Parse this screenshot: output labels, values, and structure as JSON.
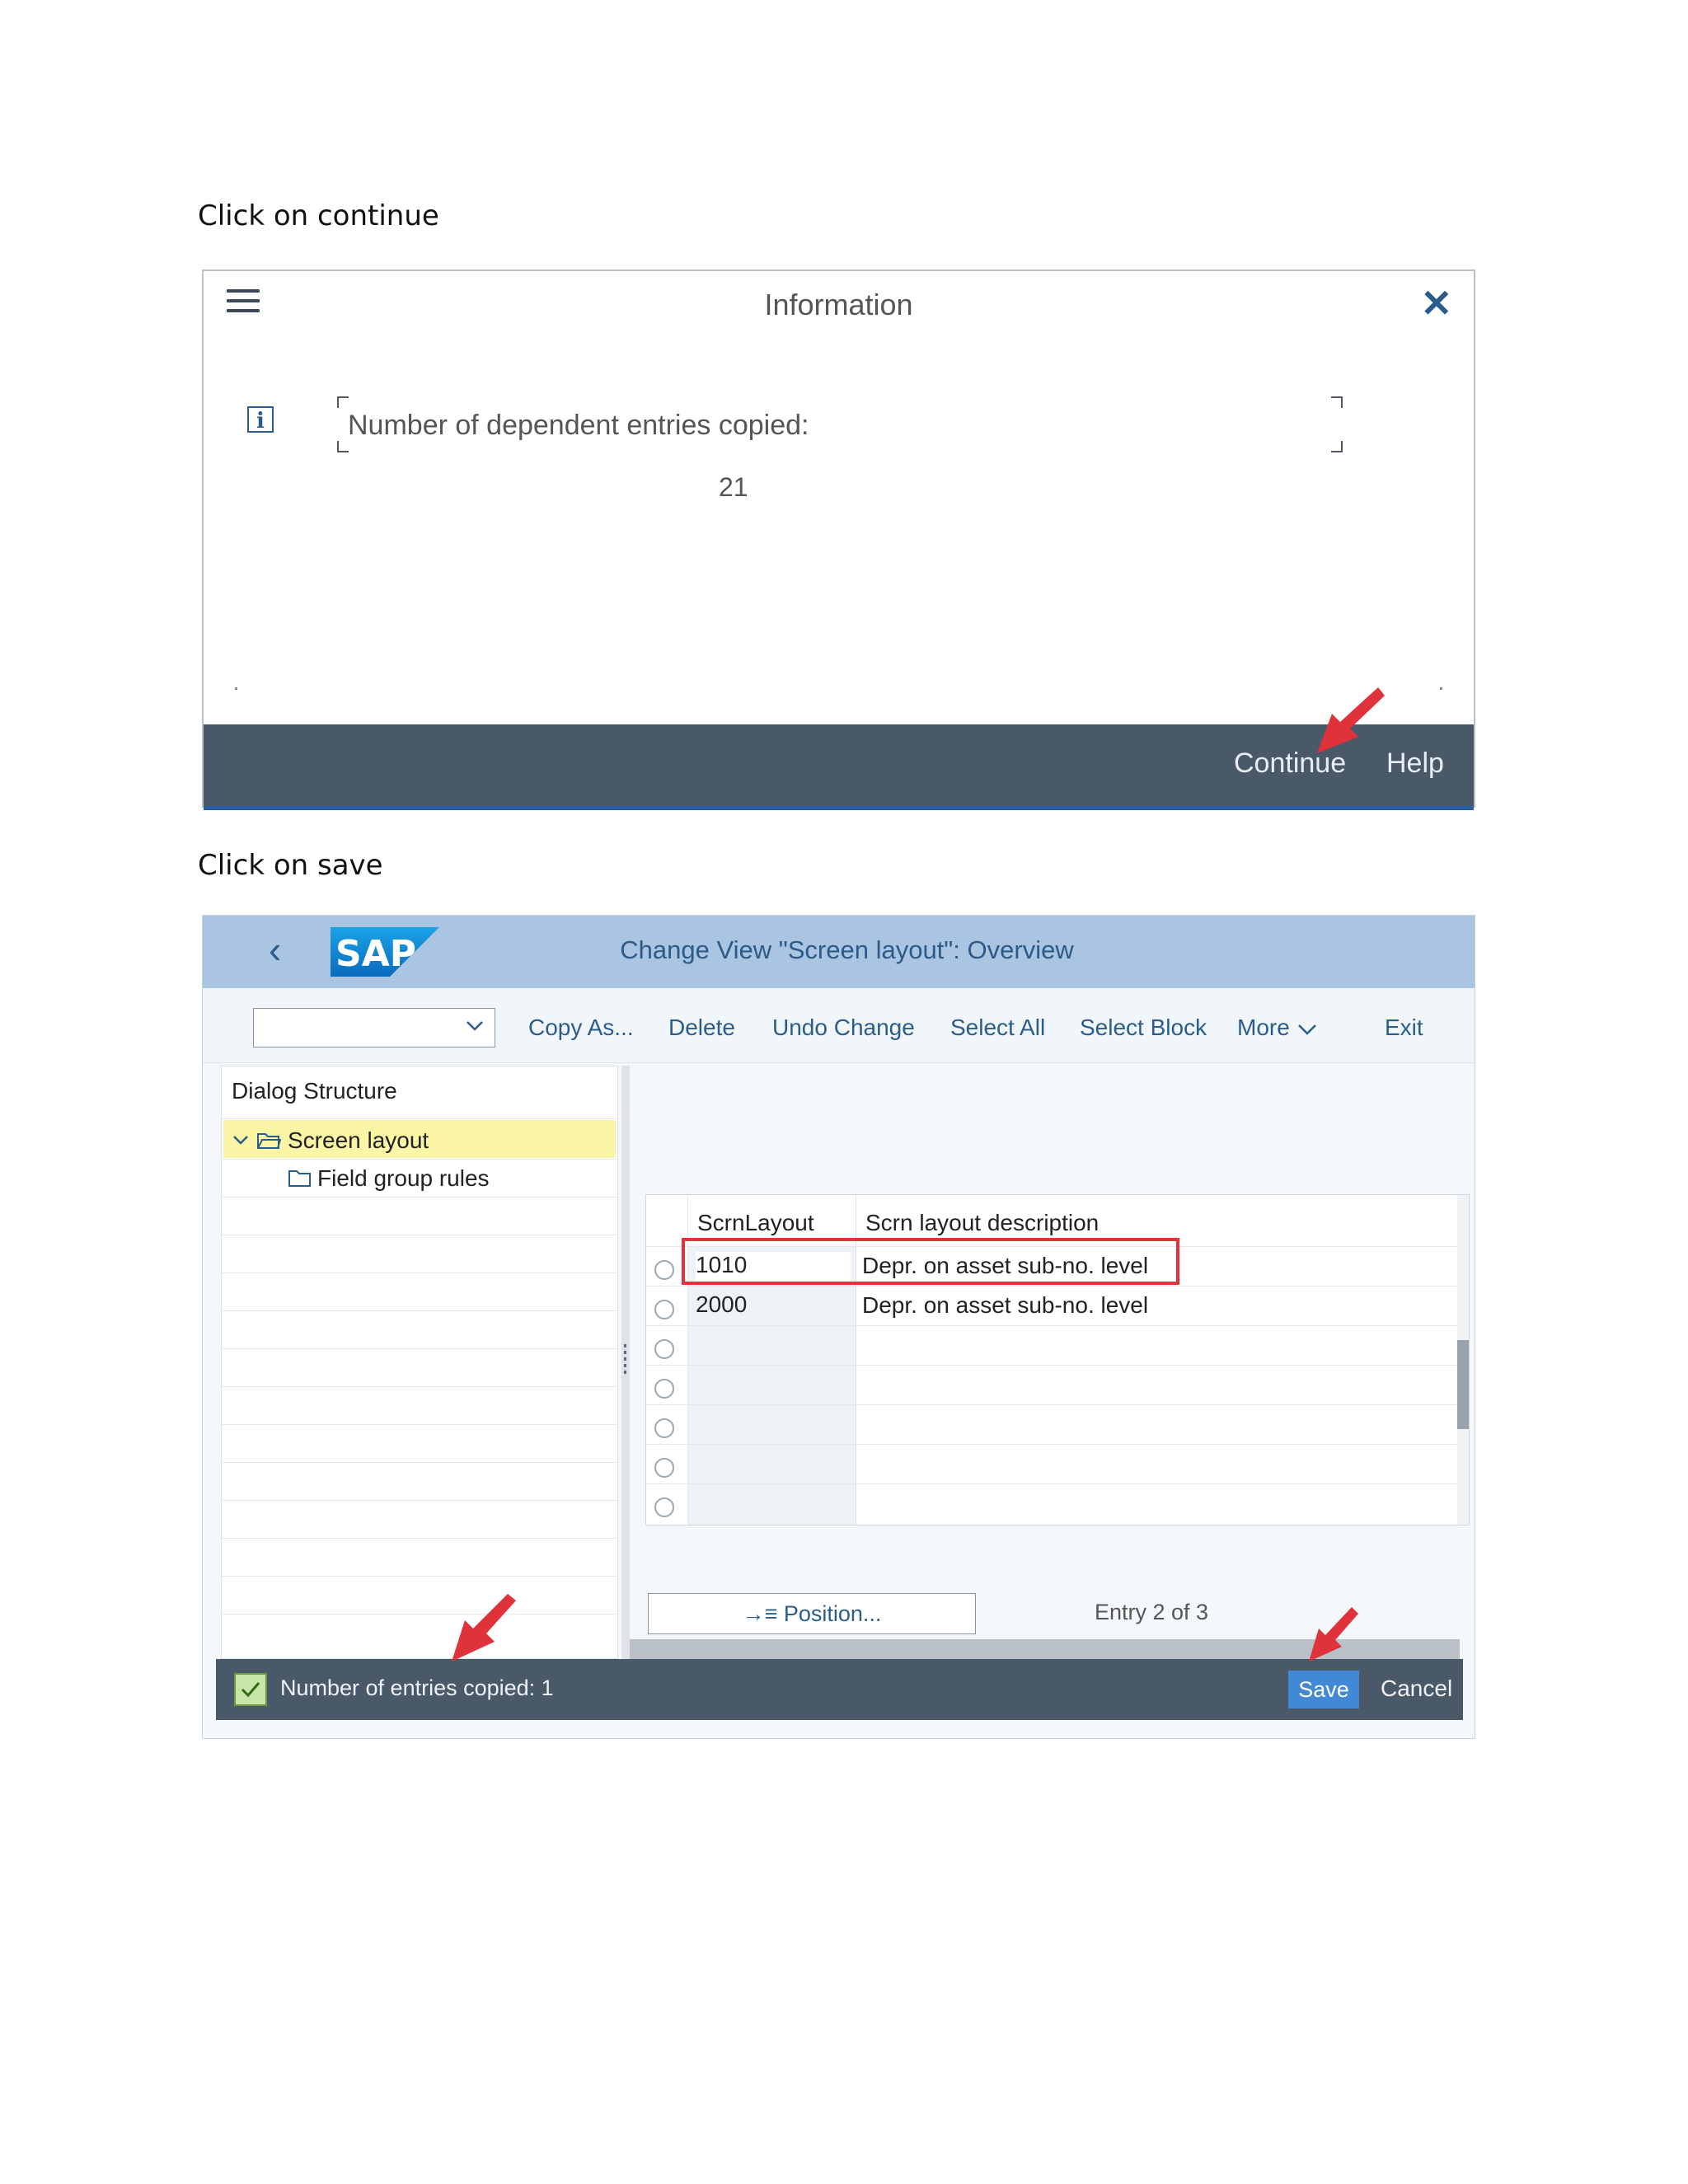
{
  "captions": {
    "first": "Click on continue",
    "second": "Click on save"
  },
  "info_dialog": {
    "title": "Information",
    "message": "Number of dependent entries copied:",
    "count": "21",
    "buttons": {
      "continue": "Continue",
      "help": "Help"
    },
    "icons": [
      "menu-icon",
      "close-icon",
      "info-icon"
    ]
  },
  "sap_window": {
    "title": "Change View \"Screen layout\": Overview",
    "toolbar": {
      "combo_value": "",
      "copy_as": "Copy As...",
      "delete": "Delete",
      "undo_change": "Undo Change",
      "select_all": "Select All",
      "select_block": "Select Block",
      "more": "More",
      "exit": "Exit"
    },
    "dialog_structure": {
      "header": "Dialog Structure",
      "items": [
        {
          "label": "Screen layout",
          "selected": true
        },
        {
          "label": "Field group rules",
          "selected": false
        }
      ]
    },
    "table": {
      "columns": [
        "ScrnLayout",
        "Scrn layout description"
      ],
      "rows": [
        {
          "key": "1010",
          "description": "Depr. on asset sub-no. level"
        },
        {
          "key": "2000",
          "description": "Depr. on asset sub-no. level"
        }
      ]
    },
    "position_button": "Position...",
    "entry_info": "Entry 2 of 3",
    "status": {
      "message": "Number of entries copied: 1",
      "save": "Save",
      "cancel": "Cancel"
    },
    "colors": {
      "shell": "#a9c5e2",
      "footer": "#4a5968",
      "save": "#4189d6",
      "highlight": "#e0323a"
    }
  }
}
